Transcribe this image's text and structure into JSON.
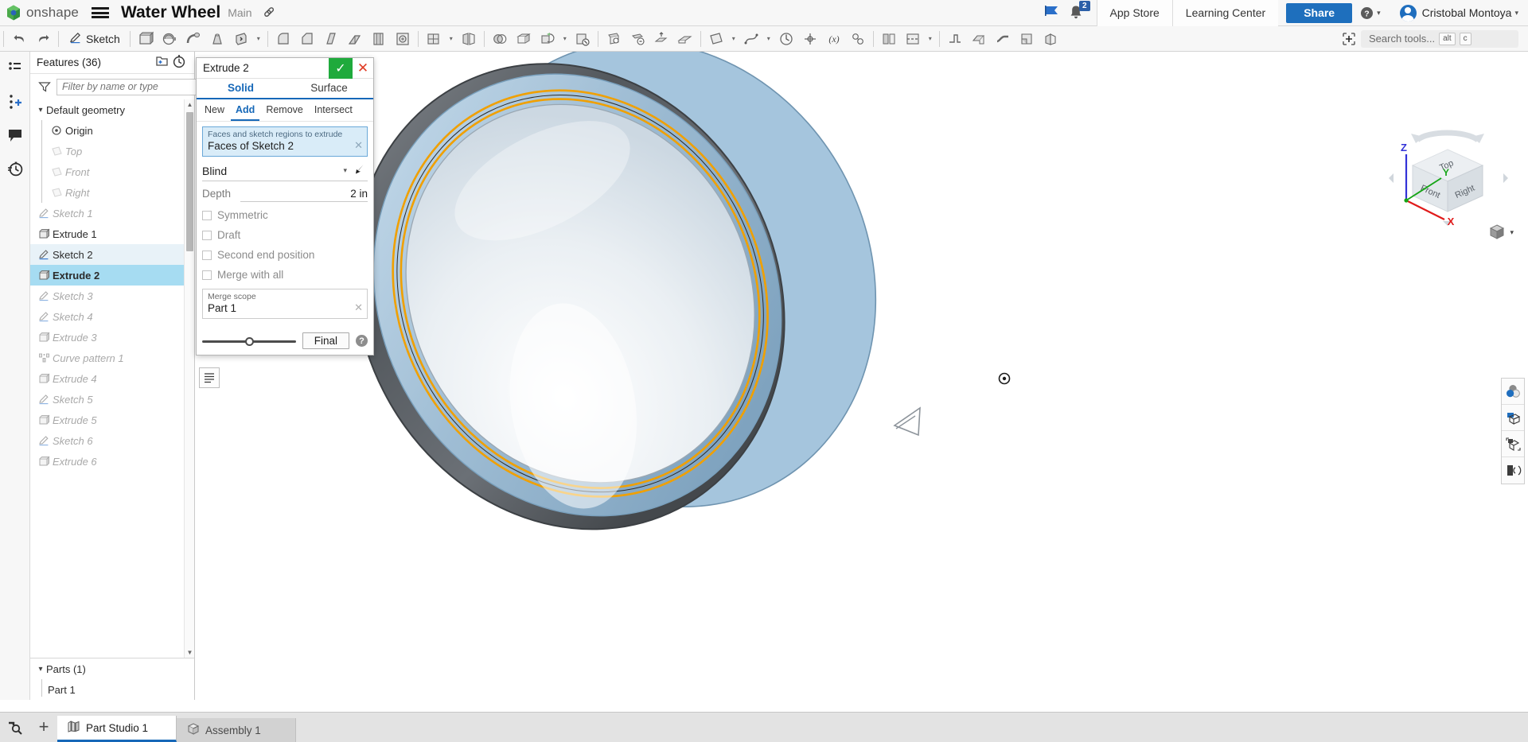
{
  "header": {
    "brand": "onshape",
    "doc_title": "Water Wheel",
    "branch": "Main",
    "menu_icon": "hamburger-menu-icon",
    "link_icon": "link-icon",
    "flag_icon": "flag-icon",
    "bell_icon": "notification-bell-icon",
    "notification_count": "2",
    "app_store": "App Store",
    "learning_center": "Learning Center",
    "share": "Share",
    "help_icon": "help-circle-icon",
    "user_name": "Cristobal Montoya"
  },
  "toolbar": {
    "undo_icon": "undo-arrow-icon",
    "redo_icon": "redo-arrow-icon",
    "sketch_label": "Sketch",
    "sketch_icon": "pencil-icon",
    "search_placeholder": "Search tools...",
    "search_kbd_alt": "alt",
    "search_kbd_key": "c",
    "items": [
      "extrude-icon",
      "revolve-icon",
      "sweep-icon",
      "loft-icon",
      "thicken-icon",
      "rib-icon",
      "fillet-icon",
      "chamfer-icon",
      "draft-icon",
      "shell-icon",
      "hole-icon",
      "thread-icon",
      "linear-pattern-icon",
      "mirror-icon",
      "boolean-icon",
      "split-icon",
      "transform-icon",
      "delete-face-icon",
      "move-face-icon",
      "replace-face-icon",
      "offset-surface-icon",
      "enclose-icon",
      "plane-icon",
      "curve-icon",
      "variable-icon",
      "measure-icon",
      "mate-connector-icon",
      "composite-part-icon",
      "appearance-icon",
      "section-view-icon",
      "sheet-metal-icon",
      "flange-icon",
      "bend-icon",
      "tab-icon",
      "unfold-icon",
      "insert-part-icon"
    ]
  },
  "left_rail": {
    "items": [
      {
        "name": "feature-list-icon"
      },
      {
        "name": "add-instance-icon"
      },
      {
        "name": "comment-icon"
      },
      {
        "name": "version-history-icon"
      }
    ],
    "bottom_icon": "search-history-icon"
  },
  "features_panel": {
    "title": "Features (36)",
    "new_folder_icon": "new-folder-icon",
    "rollback_icon": "rollback-timer-icon",
    "filter_placeholder": "Filter by name or type",
    "filter_icon": "funnel-filter-icon",
    "tree": [
      {
        "label": "Default geometry",
        "icon": "chevron-down-icon",
        "kind": "group",
        "state": "normal"
      },
      {
        "label": "Origin",
        "icon": "origin-icon",
        "kind": "child",
        "state": "normal"
      },
      {
        "label": "Top",
        "icon": "plane-icon",
        "kind": "child",
        "state": "dim"
      },
      {
        "label": "Front",
        "icon": "plane-icon",
        "kind": "child",
        "state": "dim"
      },
      {
        "label": "Right",
        "icon": "plane-icon",
        "kind": "child",
        "state": "dim"
      },
      {
        "label": "Sketch 1",
        "icon": "sketch-icon",
        "kind": "feature",
        "state": "dim"
      },
      {
        "label": "Extrude 1",
        "icon": "extrude-icon",
        "kind": "feature",
        "state": "normal"
      },
      {
        "label": "Sketch 2",
        "icon": "sketch-icon",
        "kind": "feature",
        "state": "hl"
      },
      {
        "label": "Extrude 2",
        "icon": "extrude-icon",
        "kind": "feature",
        "state": "selected"
      },
      {
        "label": "Sketch 3",
        "icon": "sketch-icon",
        "kind": "feature",
        "state": "dim"
      },
      {
        "label": "Sketch 4",
        "icon": "sketch-icon",
        "kind": "feature",
        "state": "dim"
      },
      {
        "label": "Extrude 3",
        "icon": "extrude-icon",
        "kind": "feature",
        "state": "dim"
      },
      {
        "label": "Curve pattern 1",
        "icon": "curve-pattern-icon",
        "kind": "feature",
        "state": "dim"
      },
      {
        "label": "Extrude 4",
        "icon": "extrude-icon",
        "kind": "feature",
        "state": "dim"
      },
      {
        "label": "Sketch 5",
        "icon": "sketch-icon",
        "kind": "feature",
        "state": "dim"
      },
      {
        "label": "Extrude 5",
        "icon": "extrude-icon",
        "kind": "feature",
        "state": "dim"
      },
      {
        "label": "Sketch 6",
        "icon": "sketch-icon",
        "kind": "feature",
        "state": "dim"
      },
      {
        "label": "Extrude 6",
        "icon": "extrude-icon",
        "kind": "feature",
        "state": "dim"
      }
    ],
    "parts": {
      "title": "Parts (1)",
      "chevron": "chevron-down-icon",
      "items": [
        {
          "label": "Part 1"
        }
      ]
    }
  },
  "extrude_dialog": {
    "title": "Extrude 2",
    "ok_icon": "checkmark-icon",
    "cancel_icon": "close-x-icon",
    "tabs": [
      {
        "label": "Solid",
        "active": true
      },
      {
        "label": "Surface",
        "active": false
      }
    ],
    "operations": [
      {
        "label": "New",
        "active": false
      },
      {
        "label": "Add",
        "active": true
      },
      {
        "label": "Remove",
        "active": false
      },
      {
        "label": "Intersect",
        "active": false
      }
    ],
    "selection": {
      "label": "Faces and sketch regions to extrude",
      "value": "Faces of Sketch 2",
      "clear_icon": "clear-x-icon"
    },
    "end_condition": {
      "value": "Blind",
      "caret_icon": "chevron-down-icon",
      "flip_icon": "flip-direction-icon"
    },
    "depth": {
      "label": "Depth",
      "value": "2 in"
    },
    "checkboxes": [
      {
        "label": "Symmetric",
        "checked": false
      },
      {
        "label": "Draft",
        "checked": false
      },
      {
        "label": "Second end position",
        "checked": false
      },
      {
        "label": "Merge with all",
        "checked": false
      }
    ],
    "merge_scope": {
      "label": "Merge scope",
      "value": "Part 1",
      "clear_icon": "clear-x-icon"
    },
    "footer": {
      "final_label": "Final",
      "help_icon": "help-circle-icon",
      "slider_icon": "preview-slider"
    },
    "list_toggle_icon": "feature-list-toggle-icon"
  },
  "graphics": {
    "viewcube": {
      "top": "Top",
      "front": "Front",
      "right": "Right",
      "axis_x": "X",
      "axis_y": "Y",
      "axis_z": "Z",
      "color_x": "#e01b1b",
      "color_y": "#15a515",
      "color_z": "#3232d8"
    },
    "display_mode_icon": "display-style-cube-icon",
    "right_tools": [
      {
        "name": "appearance-spheres-icon"
      },
      {
        "name": "section-view-icon"
      },
      {
        "name": "explode-view-icon"
      },
      {
        "name": "render-icon"
      }
    ],
    "origin_marker": "origin-point-icon",
    "triad_marker": "sketch-plane-marker-icon",
    "model_colors": {
      "body_light": "#e8edf1",
      "body_shade": "#9fb6c8",
      "rim_dark": "#55595c",
      "highlight_orange": "#f5a300",
      "accent_blue": "#a8c8e0"
    }
  },
  "tabbar": {
    "search_icon": "tab-search-icon",
    "add_icon": "add-tab-icon",
    "tabs": [
      {
        "label": "Part Studio 1",
        "icon": "part-studio-icon",
        "active": true
      },
      {
        "label": "Assembly 1",
        "icon": "assembly-icon",
        "active": false
      }
    ]
  }
}
